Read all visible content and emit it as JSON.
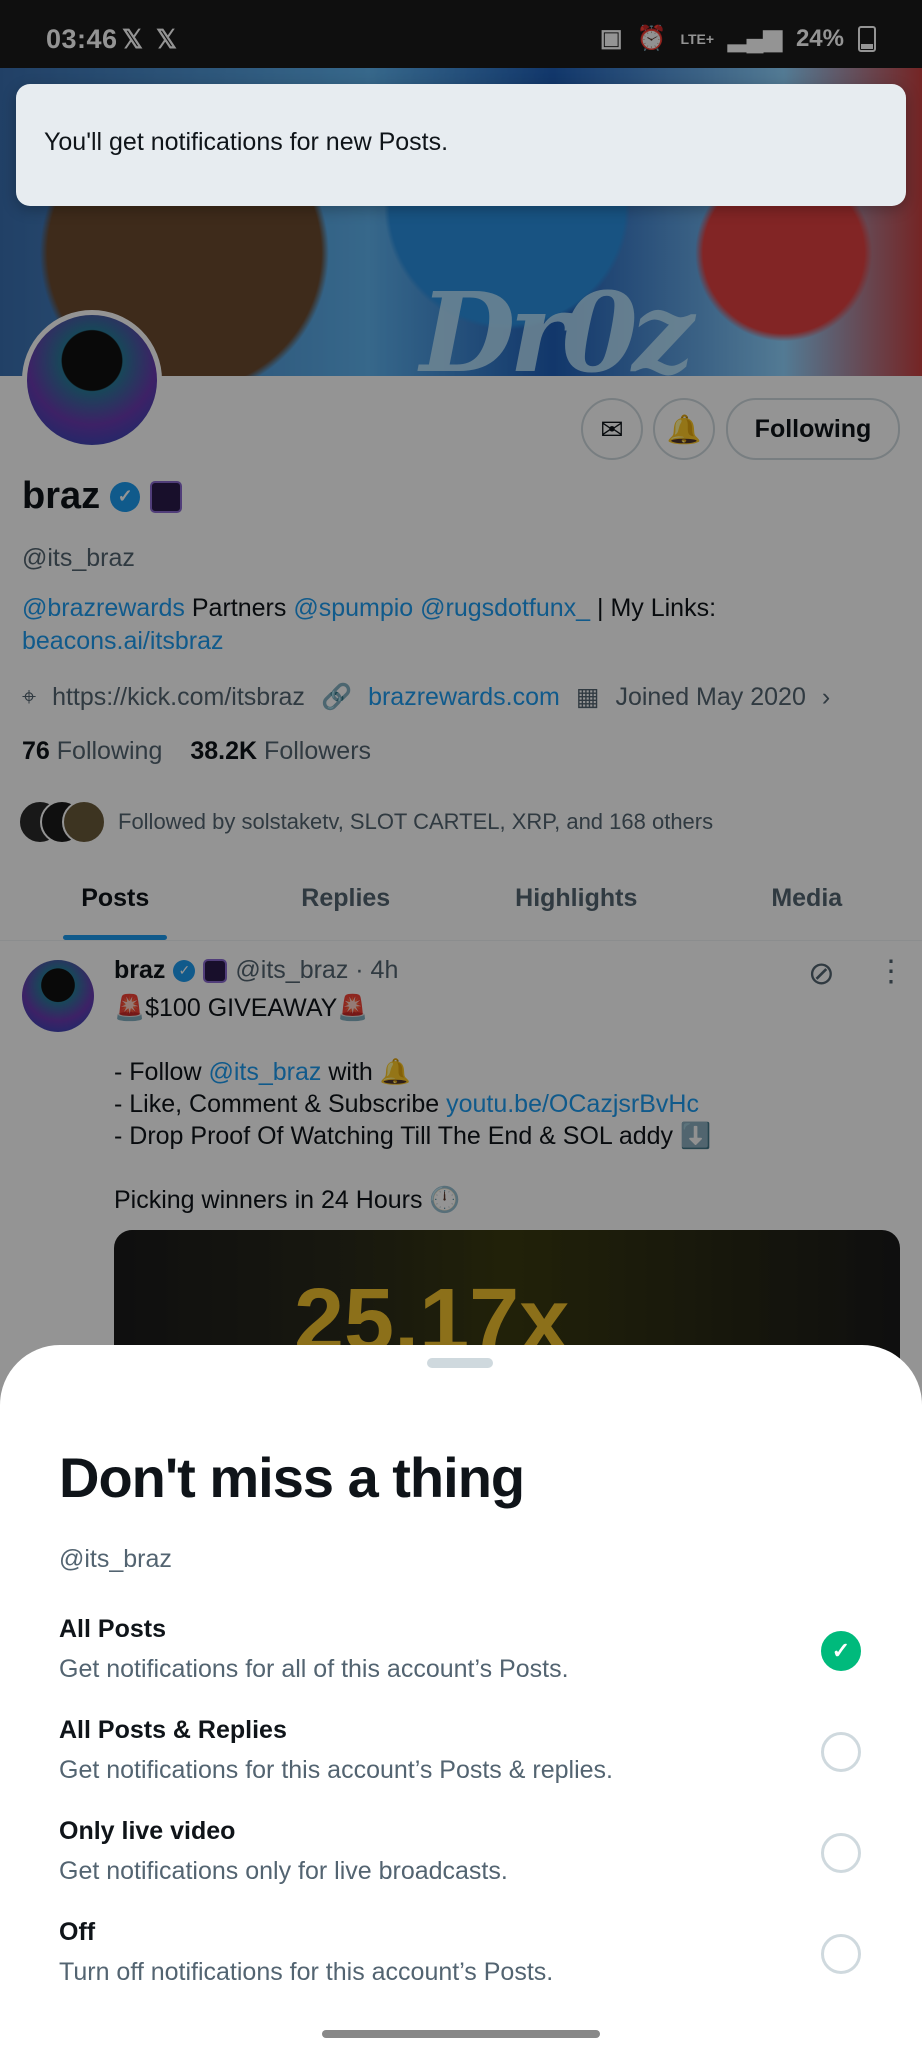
{
  "status_bar": {
    "time": "03:46",
    "x_logo_1": "𝕏",
    "x_logo_2": "𝕏",
    "battery": "24%",
    "network": "LTE+"
  },
  "profile": {
    "name": "braz",
    "handle": "@its_braz",
    "bio": {
      "mention_1": "@brazrewards",
      "text_1": " Partners ",
      "mention_2": "@spumpio",
      "mention_3": "@rugsdotfunx_",
      "text_2": " | My Links: ",
      "link": "beacons.ai/itsbraz"
    },
    "location": "https://kick.com/itsbraz",
    "website": "brazrewards.com",
    "joined": "Joined May 2020",
    "following_count": "76",
    "following_label": "Following",
    "followers_count": "38.2K",
    "followers_label": "Followers",
    "followed_by": "Followed by solstaketv, SLOT CARTEL, XRP, and 168 others",
    "following_button": "Following"
  },
  "tabs": [
    "Posts",
    "Replies",
    "Highlights",
    "Media"
  ],
  "post": {
    "name": "braz",
    "handle_time": "@its_braz · 4h",
    "title_line": "🚨$100 GIVEAWAY🚨",
    "line_follow_prefix": "- Follow ",
    "line_follow_mention": "@its_braz",
    "line_follow_suffix": " with 🔔",
    "line_like_prefix": "- Like, Comment & Subscribe ",
    "line_like_link": "youtu.be/OCazjsrBvHc",
    "line_drop": "- Drop Proof Of Watching Till The End & SOL addy ⬇️",
    "line_picking": "Picking winners in 24 Hours 🕛",
    "media_text": "25.17x"
  },
  "toast": {
    "message": "You'll get notifications for new Posts."
  },
  "sheet": {
    "title": "Don't miss a thing",
    "handle": "@its_braz",
    "options": [
      {
        "title": "All Posts",
        "desc": "Get notifications for all of this account’s Posts.",
        "selected": true
      },
      {
        "title": "All Posts & Replies",
        "desc": "Get notifications for this account’s Posts & replies.",
        "selected": false
      },
      {
        "title": "Only live video",
        "desc": "Get notifications only for live broadcasts.",
        "selected": false
      },
      {
        "title": "Off",
        "desc": "Turn off notifications for this account’s Posts.",
        "selected": false
      }
    ]
  },
  "colors": {
    "accent": "#1d9bf0",
    "selected": "#00ba7c"
  }
}
